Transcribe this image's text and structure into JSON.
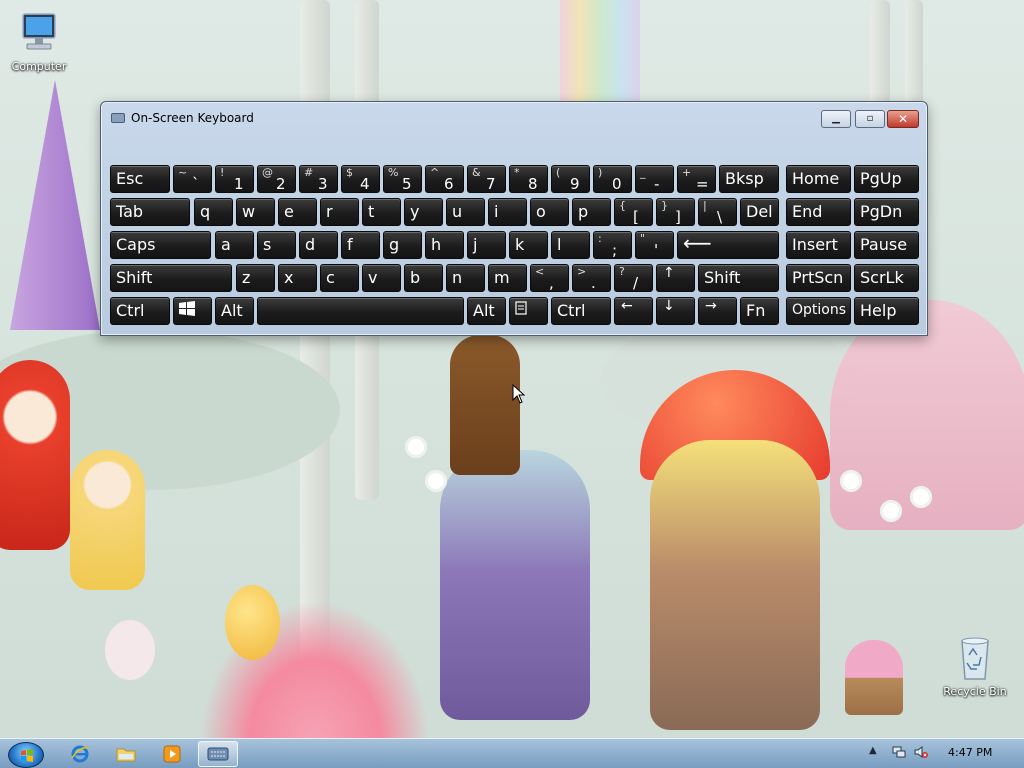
{
  "desktop": {
    "icons": [
      {
        "label": "Computer",
        "icon": "computer-icon"
      },
      {
        "label": "Recycle Bin",
        "icon": "recycle-bin-icon"
      }
    ]
  },
  "osk": {
    "title": "On-Screen Keyboard",
    "icon": "keyboard-icon",
    "window_buttons": {
      "minimize": "minimize-icon",
      "restore": "restore-icon",
      "close": "close-icon"
    },
    "keys": {
      "esc": "Esc",
      "row1": [
        {
          "shift": "~",
          "base": "`"
        },
        {
          "shift": "!",
          "base": "1"
        },
        {
          "shift": "@",
          "base": "2"
        },
        {
          "shift": "#",
          "base": "3"
        },
        {
          "shift": "$",
          "base": "4"
        },
        {
          "shift": "%",
          "base": "5"
        },
        {
          "shift": "^",
          "base": "6"
        },
        {
          "shift": "&",
          "base": "7"
        },
        {
          "shift": "*",
          "base": "8"
        },
        {
          "shift": "(",
          "base": "9"
        },
        {
          "shift": ")",
          "base": "0"
        },
        {
          "shift": "_",
          "base": "-"
        },
        {
          "shift": "+",
          "base": "="
        }
      ],
      "bksp": "Bksp",
      "home": "Home",
      "pgup": "PgUp",
      "tab": "Tab",
      "row2": [
        "q",
        "w",
        "e",
        "r",
        "t",
        "y",
        "u",
        "i",
        "o",
        "p"
      ],
      "row2_sym": [
        {
          "shift": "{",
          "base": "["
        },
        {
          "shift": "}",
          "base": "]"
        },
        {
          "shift": "|",
          "base": "\\"
        }
      ],
      "del": "Del",
      "end": "End",
      "pgdn": "PgDn",
      "caps": "Caps",
      "row3": [
        "a",
        "s",
        "d",
        "f",
        "g",
        "h",
        "j",
        "k",
        "l"
      ],
      "row3_sym": [
        {
          "shift": ":",
          "base": ";"
        },
        {
          "shift": "\"",
          "base": "'"
        }
      ],
      "enter": "⟵",
      "insert": "Insert",
      "pause": "Pause",
      "shift_left": "Shift",
      "row4": [
        "z",
        "x",
        "c",
        "v",
        "b",
        "n",
        "m"
      ],
      "row4_sym": [
        {
          "shift": "<",
          "base": ","
        },
        {
          "shift": ">",
          "base": "."
        },
        {
          "shift": "?",
          "base": "/"
        }
      ],
      "up": "↑",
      "shift_right": "Shift",
      "prtscn": "PrtScn",
      "scrlk": "ScrLk",
      "ctrl_left": "Ctrl",
      "win": "windows-logo-icon",
      "alt_left": "Alt",
      "space": "",
      "alt_right": "Alt",
      "menu": "menu-key-icon",
      "ctrl_right": "Ctrl",
      "left": "←",
      "down": "↓",
      "right": "→",
      "fn": "Fn",
      "options": "Options",
      "help": "Help"
    }
  },
  "taskbar": {
    "start": "start-orb-icon",
    "pinned": [
      "internet-explorer-icon",
      "windows-explorer-icon",
      "media-player-icon",
      "on-screen-keyboard-icon"
    ],
    "active_index": 3,
    "tray": [
      "show-hidden-icons-arrow",
      "network-icon",
      "volume-muted-icon"
    ],
    "clock": "4:47 PM"
  }
}
